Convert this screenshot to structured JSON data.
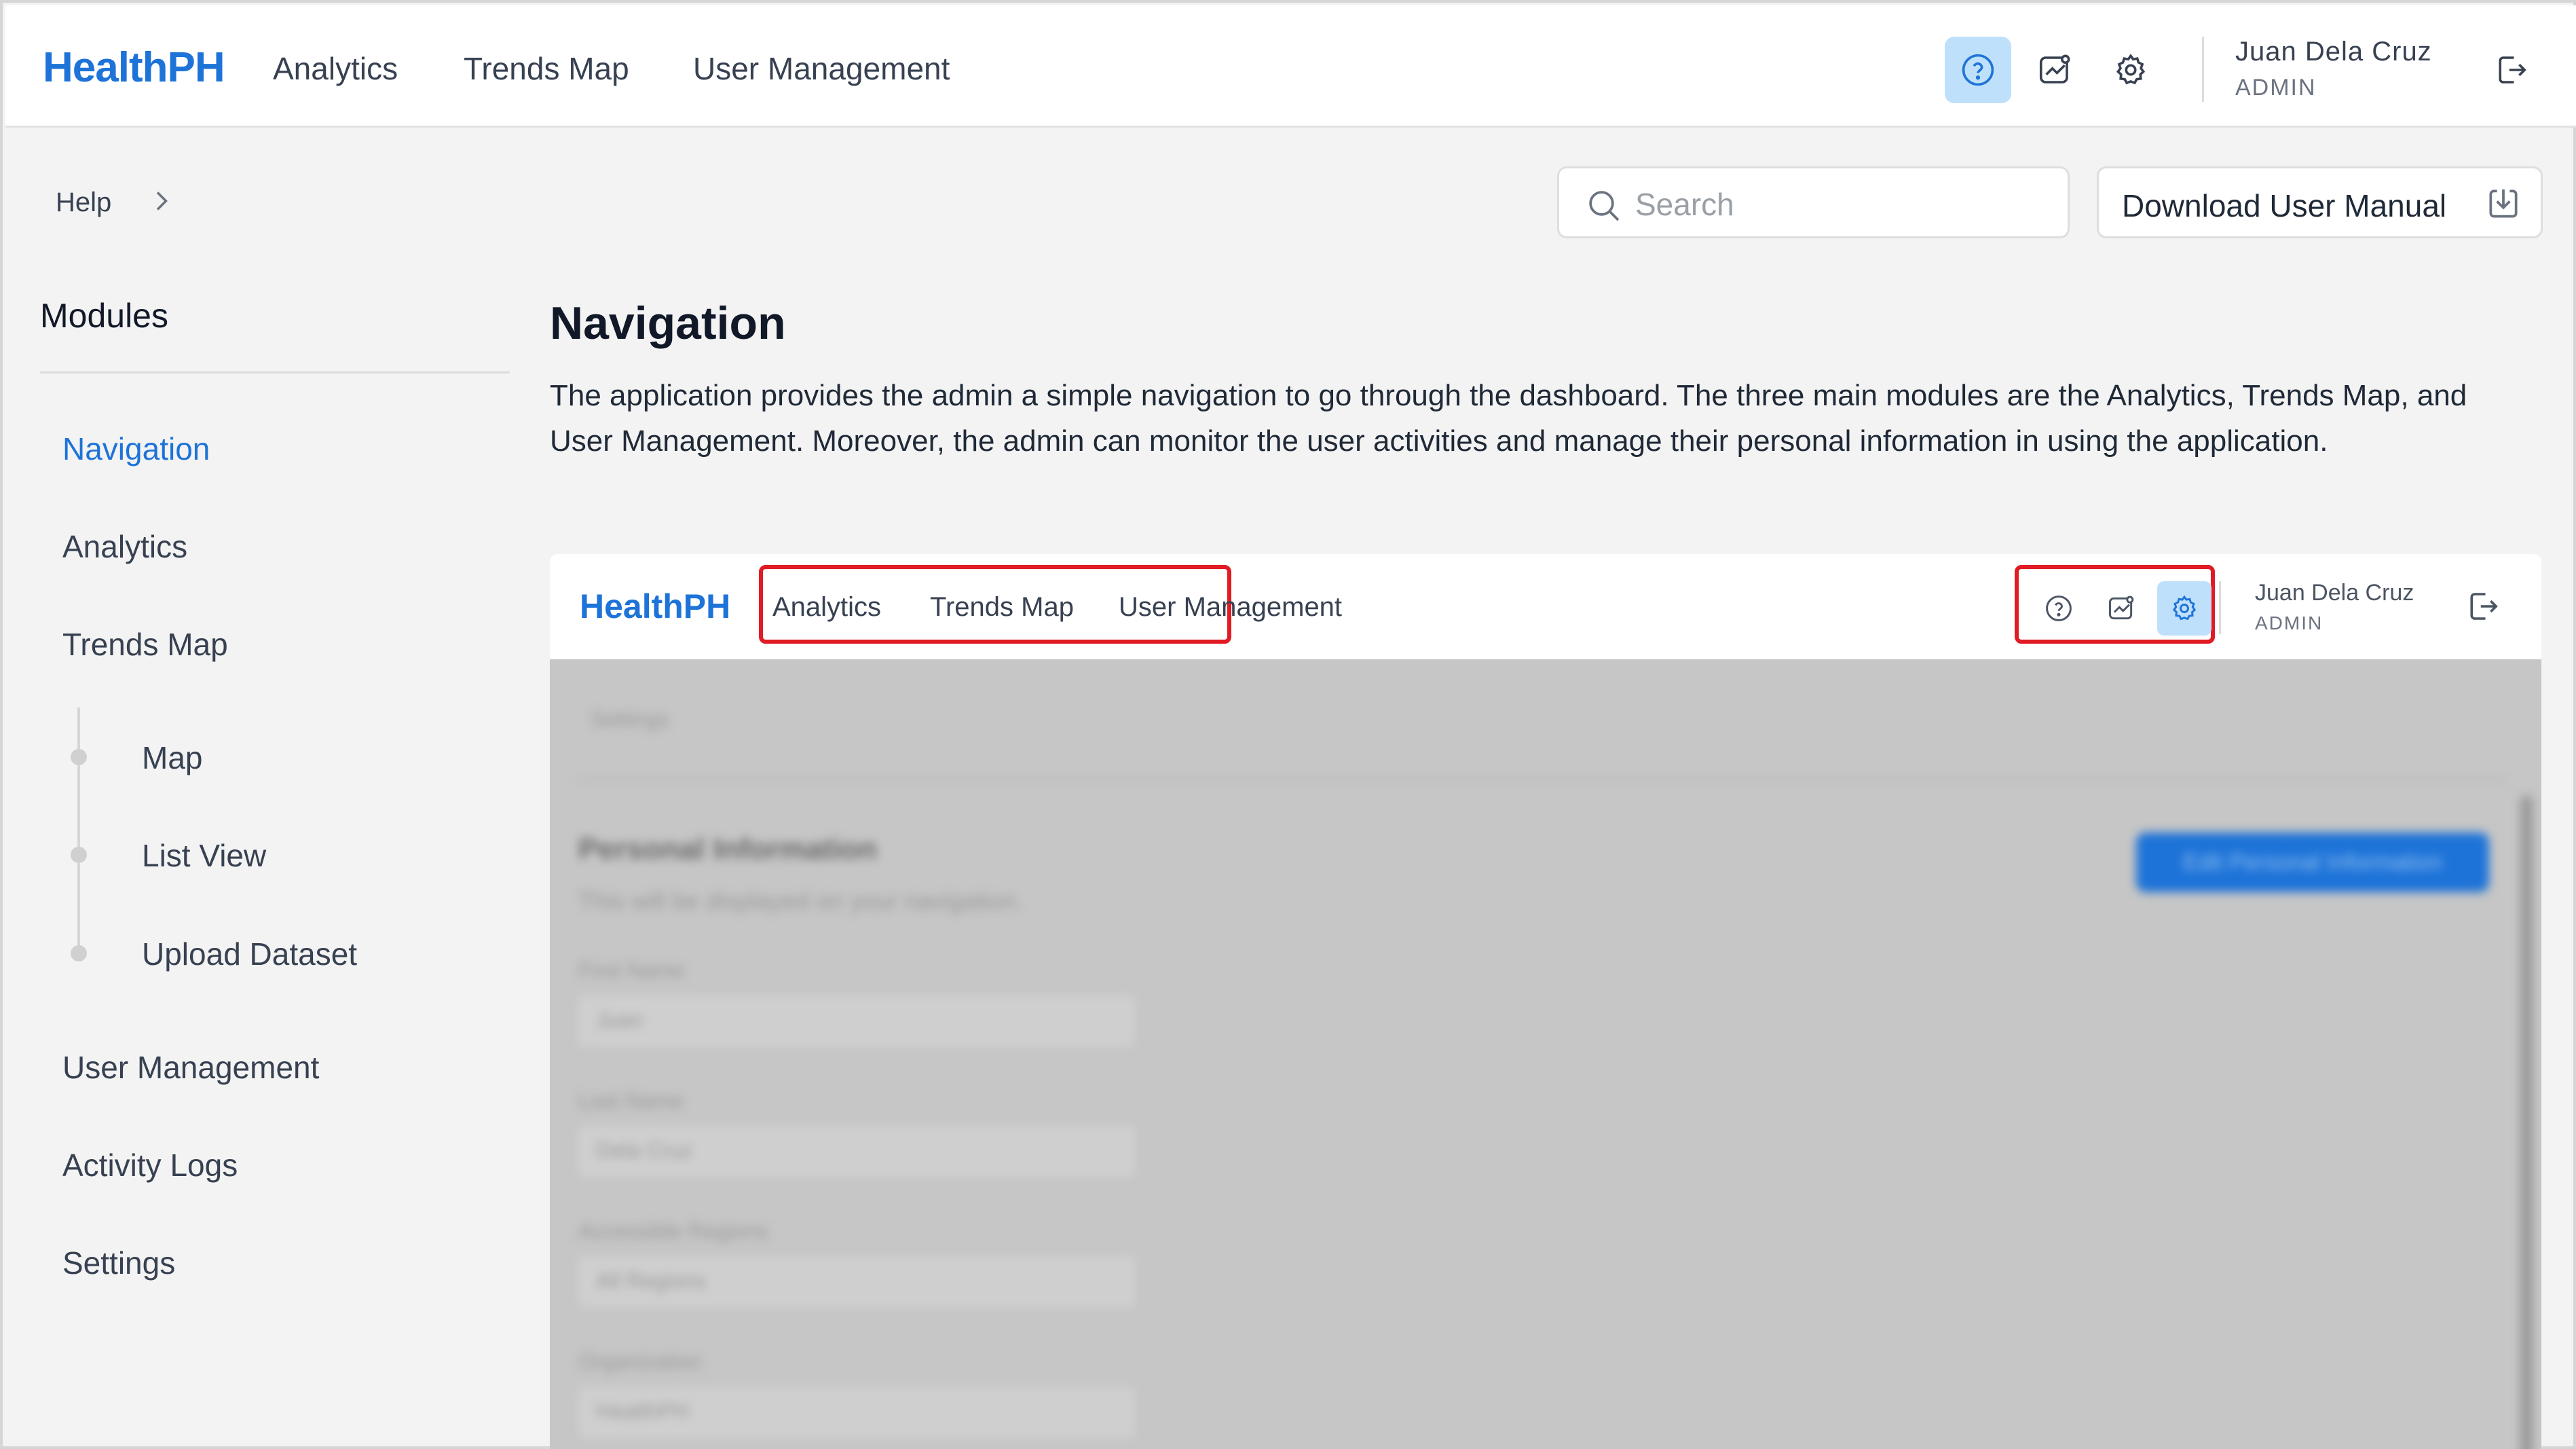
{
  "header": {
    "brand": "HealthPH",
    "nav": [
      "Analytics",
      "Trends Map",
      "User Management"
    ],
    "icons": [
      "help-icon",
      "trend-chart-icon",
      "gear-icon",
      "logout-icon"
    ],
    "user_name": "Juan Dela Cruz",
    "user_role": "ADMIN"
  },
  "breadcrumb": {
    "label": "Help"
  },
  "search": {
    "placeholder": "Search"
  },
  "download": {
    "label": "Download User Manual"
  },
  "sidebar": {
    "title": "Modules",
    "items": [
      {
        "label": "Navigation",
        "active": true
      },
      {
        "label": "Analytics"
      },
      {
        "label": "Trends Map"
      }
    ],
    "sub_items": [
      "Map",
      "List View",
      "Upload Dataset"
    ],
    "items_bottom": [
      "User Management",
      "Activity Logs",
      "Settings"
    ]
  },
  "main": {
    "title": "Navigation",
    "description": "The application provides the admin a simple navigation to go through the dashboard. The three main modules are the Analytics, Trends Map, and User Management. Moreover, the admin can monitor the user activities and manage their personal information in using the application."
  },
  "screenshot": {
    "brand": "HealthPH",
    "nav": [
      "Analytics",
      "Trends Map",
      "User Management"
    ],
    "user_name": "Juan Dela Cruz",
    "user_role": "ADMIN",
    "blurred": {
      "breadcrumb": "Settings",
      "section_title": "Personal Information",
      "section_subtitle": "This will be displayed on your navigation.",
      "button": "Edit Personal Information",
      "fields": [
        {
          "label": "First Name",
          "value": "Juan"
        },
        {
          "label": "Last Name",
          "value": "Dela Cruz"
        },
        {
          "label": "Accessible Regions",
          "value": "All Regions"
        },
        {
          "label": "Organization",
          "value": "HealthPH"
        }
      ]
    }
  },
  "colors": {
    "accent": "#1e73d8",
    "highlight": "#e01b24",
    "active_bg": "#bfe0fb"
  }
}
